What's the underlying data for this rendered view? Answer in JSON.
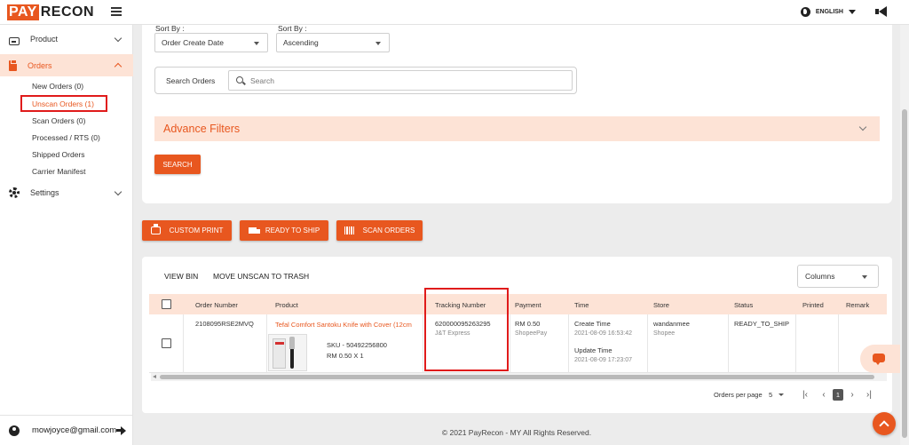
{
  "app": {
    "logo_pay": "PAY",
    "logo_recon": "RECON",
    "language": "ENGLISH",
    "brand_color": "#e8571f"
  },
  "sidebar": {
    "items": [
      {
        "label": "Product",
        "icon": "tray-icon"
      },
      {
        "label": "Orders",
        "icon": "clipboard-icon",
        "active": true
      },
      {
        "label": "Settings",
        "icon": "gear-icon"
      }
    ],
    "orders_sub": [
      {
        "label": "New Orders (0)"
      },
      {
        "label": "Unscan Orders (1)",
        "current": true
      },
      {
        "label": "Scan Orders (0)"
      },
      {
        "label": "Processed / RTS (0)"
      },
      {
        "label": "Shipped Orders"
      },
      {
        "label": "Carrier Manifest"
      }
    ],
    "user_email": "mowjoyce@gmail.com"
  },
  "filters": {
    "sort_by_label_1": "Sort By :",
    "sort_by_value_1": "Order Create Date",
    "sort_by_label_2": "Sort By :",
    "sort_by_value_2": "Ascending",
    "search_label": "Search Orders",
    "search_placeholder": "Search",
    "advance_filters": "Advance Filters",
    "search_button": "SEARCH"
  },
  "actions": {
    "custom_print": "CUSTOM PRINT",
    "ready_to_ship": "READY TO SHIP",
    "scan_orders": "SCAN ORDERS"
  },
  "table": {
    "view_bin": "VIEW BIN",
    "move_to_trash": "MOVE UNSCAN TO TRASH",
    "columns_select": "Columns",
    "headers": [
      "Order Number",
      "Product",
      "Tracking Number",
      "Payment",
      "Time",
      "Store",
      "Status",
      "Printed",
      "Remark"
    ],
    "rows": [
      {
        "order_number": "2108095RSE2MVQ",
        "product_name": "Tefal Comfort Santoku Knife with Cover (12cm",
        "sku": "SKU - 50492256800",
        "price_qty": "RM 0.50 X 1",
        "tracking_number": "620000095263295",
        "carrier": "J&T Express",
        "payment_amount": "RM 0.50",
        "payment_method": "ShopeePay",
        "create_time_label": "Create Time",
        "create_time": "2021-08-09 16:53:42",
        "update_time_label": "Update Time",
        "update_time": "2021-08-09 17:23:07",
        "store_name": "wandanmee",
        "store_platform": "Shopee",
        "status": "READY_TO_SHIP"
      }
    ]
  },
  "pagination": {
    "per_page_label": "Orders per page",
    "per_page": "5",
    "current_page": "1"
  },
  "footer": "© 2021 PayRecon - MY All Rights Reserved."
}
